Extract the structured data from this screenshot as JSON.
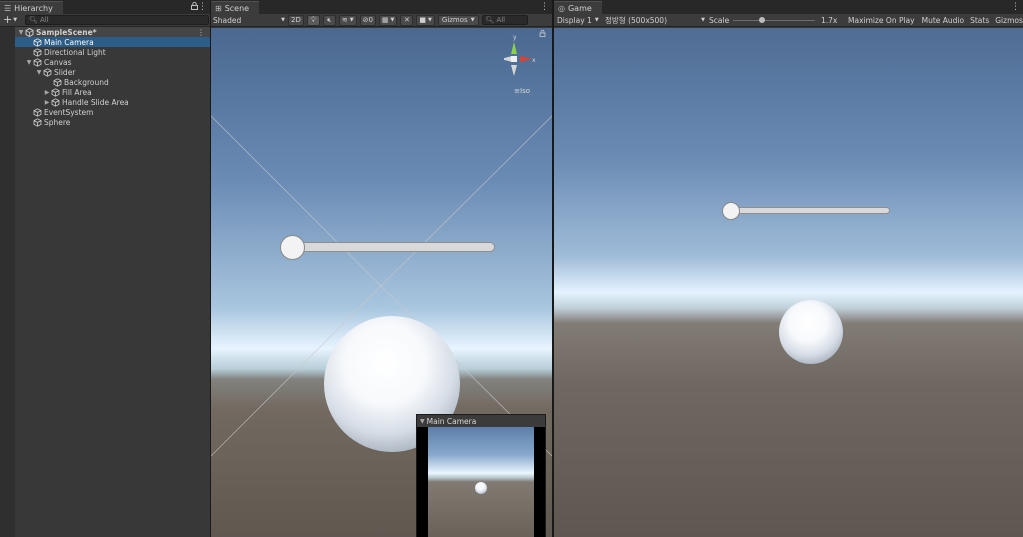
{
  "hierarchy": {
    "tab_title": "Hierarchy",
    "search_placeholder": "All",
    "scene_name": "SampleScene*",
    "items": [
      {
        "label": "Main Camera"
      },
      {
        "label": "Directional Light"
      },
      {
        "label": "Canvas"
      },
      {
        "label": "Slider"
      },
      {
        "label": "Background"
      },
      {
        "label": "Fill Area"
      },
      {
        "label": "Handle Slide Area"
      },
      {
        "label": "EventSystem"
      },
      {
        "label": "Sphere"
      }
    ],
    "selected_item": "Main Camera"
  },
  "scene": {
    "tab_title": "Scene",
    "shading_mode": "Shaded",
    "mode_2d": "2D",
    "hidden_objects_count": "0",
    "gizmos_label": "Gizmos",
    "search_placeholder": "All",
    "gizmo_axes": {
      "y": "y",
      "x": "x"
    },
    "projection_label": "Iso",
    "camera_preview_title": "Main Camera"
  },
  "game": {
    "tab_title": "Game",
    "display": "Display 1",
    "resolution": "정방형 (500x500)",
    "scale_label": "Scale",
    "scale_value": "1.7x",
    "scale_fraction": 0.35,
    "maximize_label": "Maximize On Play",
    "mute_label": "Mute Audio",
    "stats_label": "Stats",
    "gizmos_label": "Gizmos"
  },
  "colors": {
    "selection": "#2c5d87",
    "panel_bg": "#383838",
    "toolbar_bg": "#3c3c3c",
    "tab_bg": "#282828",
    "gizmo_x": "#d9432f",
    "gizmo_y": "#8dd04a"
  },
  "icons": {
    "hierarchy_tab": "list-icon",
    "scene_tab": "grid-icon",
    "game_tab": "gamepad-icon",
    "object": "cube-icon",
    "scene_root": "unity-scene-icon"
  }
}
